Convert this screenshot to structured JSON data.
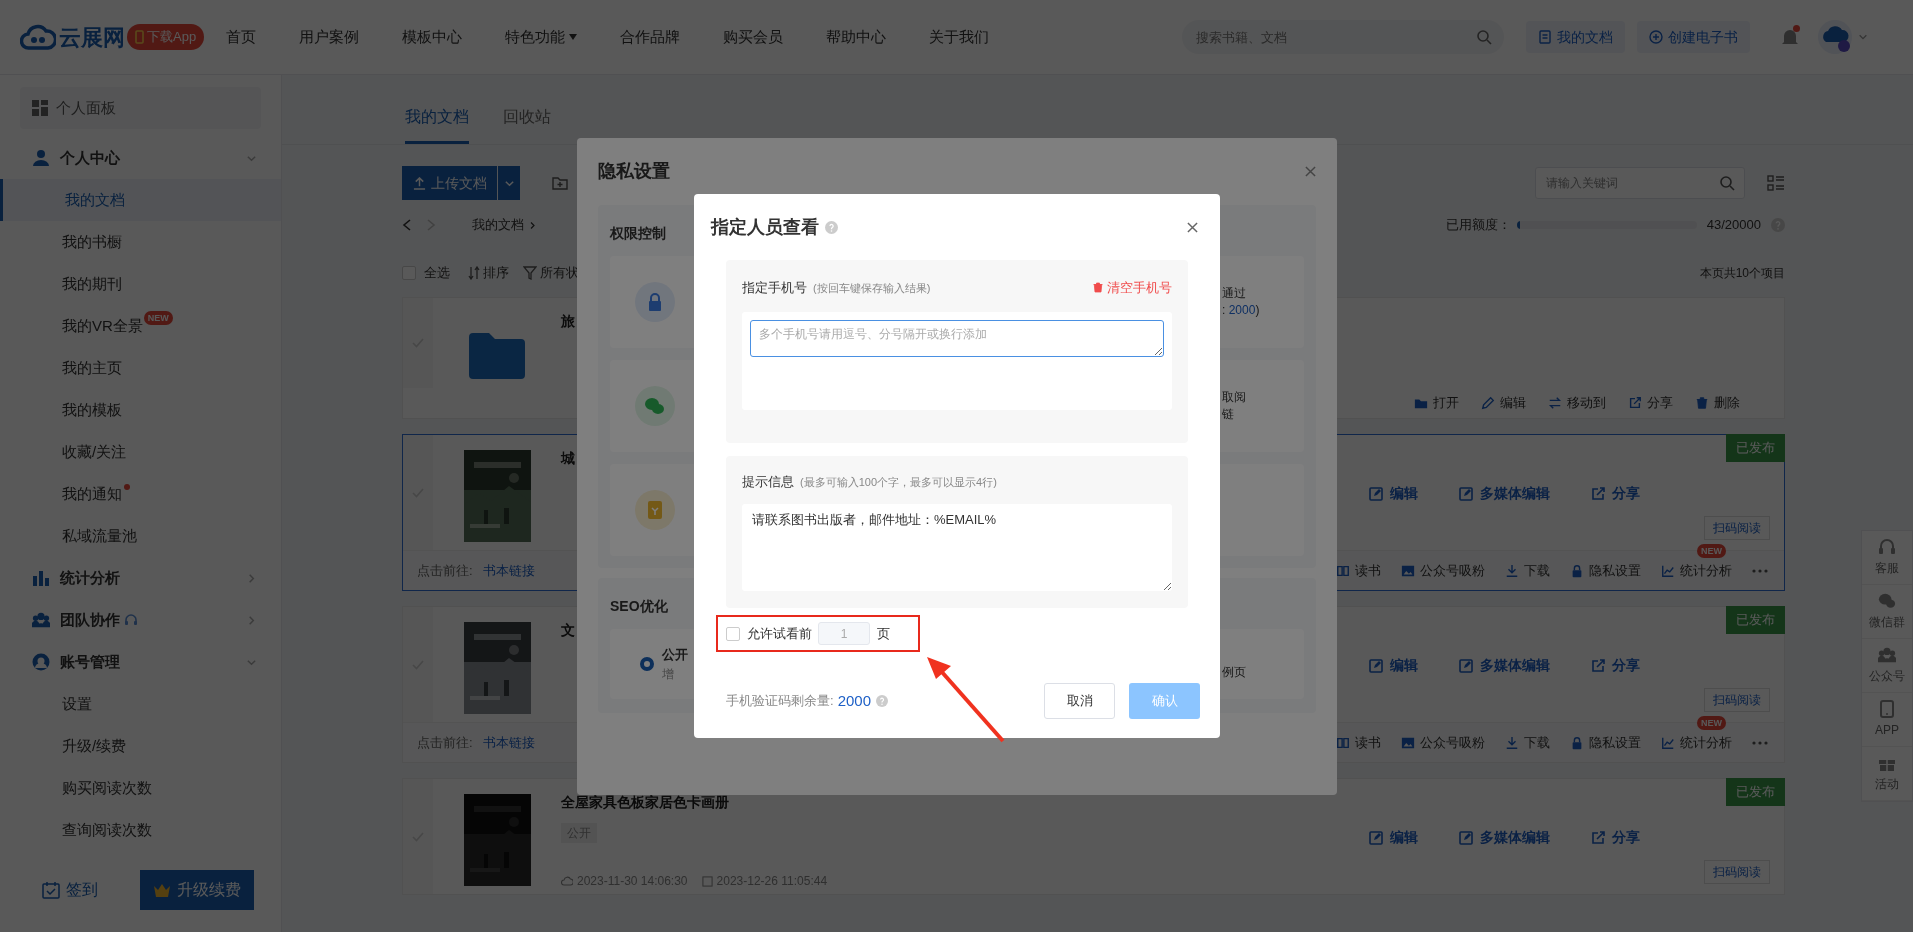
{
  "top_nav": {
    "logo": "云展网",
    "app_badge": "下载App",
    "links": [
      {
        "label": "首页",
        "has_menu": false
      },
      {
        "label": "用户案例",
        "has_menu": false
      },
      {
        "label": "模板中心",
        "has_menu": false
      },
      {
        "label": "特色功能",
        "has_menu": true
      },
      {
        "label": "合作品牌",
        "has_menu": false
      },
      {
        "label": "购买会员",
        "has_menu": false
      },
      {
        "label": "帮助中心",
        "has_menu": false
      },
      {
        "label": "关于我们",
        "has_menu": false
      }
    ],
    "search": {
      "placeholder": "搜索书籍、文档"
    },
    "buttons": [
      "我的文档",
      "创建电子书"
    ],
    "has_notice": true
  },
  "sidebar": {
    "items": [
      {
        "kind": "panel",
        "label": "个人面板"
      },
      {
        "kind": "group",
        "label": "个人中心",
        "expanded": true,
        "children": [
          {
            "label": "我的文档",
            "selected": true
          },
          {
            "label": "我的书橱",
            "selected": false
          },
          {
            "label": "我的期刊",
            "selected": false
          },
          {
            "label": "我的VR全景",
            "selected": false,
            "badge": "NEW"
          },
          {
            "label": "我的主页",
            "selected": false
          },
          {
            "label": "我的模板",
            "selected": false
          },
          {
            "label": "收藏/关注",
            "selected": false
          },
          {
            "label": "我的通知",
            "selected": false,
            "dot": true
          },
          {
            "label": "私域流量池",
            "selected": false
          }
        ]
      },
      {
        "kind": "group",
        "label": "统计分析",
        "expanded": false
      },
      {
        "kind": "group",
        "label": "团队协作",
        "expanded": false,
        "support": true
      },
      {
        "kind": "group",
        "label": "账号管理",
        "expanded": true,
        "children": [
          {
            "label": "设置",
            "selected": false
          },
          {
            "label": "升级/续费",
            "selected": false
          },
          {
            "label": "购买阅读次数",
            "selected": false
          },
          {
            "label": "查询阅读次数",
            "selected": false
          }
        ]
      }
    ],
    "footer": {
      "checkin": "签到",
      "upgrade": "升级续费"
    }
  },
  "main": {
    "tabs": [
      {
        "label": "我的文档",
        "selected": true
      },
      {
        "label": "回收站",
        "selected": false
      }
    ],
    "upload_button": "上传文档",
    "search": {
      "placeholder": "请输入关键词"
    },
    "breadcrumb": "我的文档",
    "quota": {
      "label": "已用额度：",
      "level": 0.02,
      "reading": "43/20000"
    },
    "list_header": {
      "select_all": {
        "label": "全选",
        "checked": false
      },
      "sort": "排序",
      "filter": "所有状",
      "count": "本页共10个项目"
    },
    "cards": [
      {
        "kind": "folder",
        "title": "旅",
        "selected": false,
        "actions": [
          "打开",
          "编辑",
          "移动到",
          "分享",
          "删除"
        ]
      },
      {
        "kind": "book",
        "title": "城",
        "selected": true,
        "status": "已发布",
        "actions": [
          "编辑",
          "多媒体编辑",
          "分享"
        ],
        "scan": "扫码阅读",
        "link_label": "点击前往:",
        "link": "书本链接",
        "tools": [
          {
            "label": "读书"
          },
          {
            "label": "公众号吸粉"
          },
          {
            "label": "下载"
          },
          {
            "label": "隐私设置"
          },
          {
            "label": "统计分析",
            "badge": "NEW"
          }
        ]
      },
      {
        "kind": "book",
        "title": "文",
        "selected": false,
        "status": "已发布",
        "actions": [
          "编辑",
          "多媒体编辑",
          "分享"
        ],
        "scan": "扫码阅读",
        "link_label": "点击前往:",
        "link": "书本链接",
        "tools": [
          {
            "label": "读书"
          },
          {
            "label": "公众号吸粉"
          },
          {
            "label": "下载"
          },
          {
            "label": "隐私设置"
          },
          {
            "label": "统计分析",
            "badge": "NEW"
          }
        ]
      },
      {
        "kind": "book",
        "title": "全屋家具色板家居色卡画册",
        "selected": false,
        "tag": "公开",
        "created": "2023-11-30 14:06:30",
        "updated": "2023-12-26 11:05:44",
        "status": "已发布",
        "actions": [
          "编辑",
          "多媒体编辑",
          "分享"
        ],
        "scan": "扫码阅读"
      }
    ]
  },
  "float_bar": [
    "客服",
    "微信群",
    "公众号",
    "APP",
    "活动"
  ],
  "privacy_modal": {
    "title": "隐私设置",
    "permission_label": "权限控制",
    "options": [
      {
        "kind": "password",
        "lines": [
          "通过"
        ],
        "quota": {
          "before": ": ",
          "number": "2000",
          "after": ")"
        }
      },
      {
        "kind": "wechat",
        "lines": [
          "取阅",
          "链"
        ]
      },
      {
        "kind": "purchase"
      }
    ],
    "seo_label": "SEO优化",
    "seo_option": {
      "selected": true,
      "title": "公开",
      "desc": "增",
      "side": "例页"
    }
  },
  "people_modal": {
    "title": "指定人员查看",
    "phones": {
      "label": "指定手机号",
      "hint": "(按回车键保存输入结果)",
      "clear": "清空手机号",
      "placeholder": "多个手机号请用逗号、分号隔开或换行添加",
      "focused": true
    },
    "tip": {
      "label": "提示信息",
      "hint": "(最多可输入100个字，最多可以显示4行)",
      "value": "请联系图书出版者，邮件地址：%EMAIL%"
    },
    "trial": {
      "checked": false,
      "label": "允许试看前",
      "value": "1",
      "disabled": true,
      "unit": "页"
    },
    "sms_quota": {
      "label": "手机验证码剩余量:",
      "number": "2000"
    },
    "cancel": "取消",
    "confirm": {
      "label": "确认",
      "disabled": true
    }
  }
}
